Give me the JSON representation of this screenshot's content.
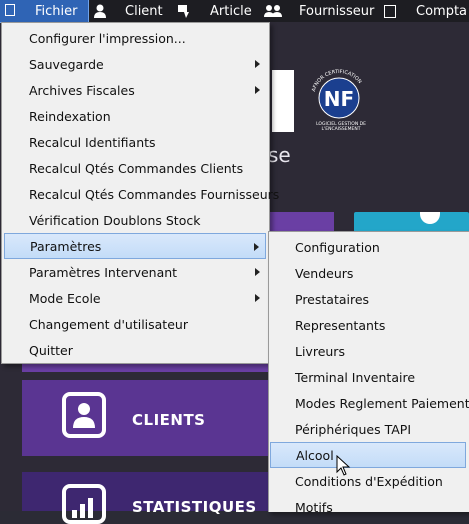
{
  "menubar": {
    "items": [
      {
        "label": "Fichier",
        "icon": "file-icon",
        "active": true
      },
      {
        "label": "Client",
        "icon": "person-icon"
      },
      {
        "label": "Article",
        "icon": "tag-icon"
      },
      {
        "label": "Fournisseur",
        "icon": "people-icon"
      },
      {
        "label": "Compta",
        "icon": "calculator-icon"
      }
    ]
  },
  "background": {
    "cert_logo_text": "NF",
    "cert_logo_sub": "LOGICIEL GESTION DE L'ENCAISSEMENT",
    "cert_logo_arc": "AFNOR CERTIFICATION",
    "partial_text": "se",
    "tiles": [
      {
        "label": "CLIENTS",
        "icon": "client-card-icon"
      },
      {
        "label": "STATISTIQUES",
        "icon": "bar-chart-icon"
      }
    ]
  },
  "fichier_menu": {
    "items": [
      {
        "label": "Configurer l'impression...",
        "submenu": false
      },
      {
        "label": "Sauvegarde",
        "submenu": true
      },
      {
        "label": "Archives Fiscales",
        "submenu": true
      },
      {
        "label": "Reindexation",
        "submenu": false
      },
      {
        "label": "Recalcul Identifiants",
        "submenu": false
      },
      {
        "label": "Recalcul Qtés Commandes Clients",
        "submenu": false
      },
      {
        "label": "Recalcul Qtés Commandes Fournisseurs",
        "submenu": false
      },
      {
        "label": "Vérification Doublons Stock",
        "submenu": false
      },
      {
        "label": "Paramètres",
        "submenu": true,
        "highlighted": true
      },
      {
        "label": "Paramètres Intervenant",
        "submenu": true
      },
      {
        "label": "Mode Ecole",
        "submenu": true
      },
      {
        "label": "Changement d'utilisateur",
        "submenu": false
      },
      {
        "label": "Quitter",
        "submenu": false
      }
    ]
  },
  "parametres_menu": {
    "items": [
      {
        "label": "Configuration"
      },
      {
        "label": "Vendeurs"
      },
      {
        "label": "Prestataires"
      },
      {
        "label": "Representants"
      },
      {
        "label": "Livreurs"
      },
      {
        "label": "Terminal Inventaire"
      },
      {
        "label": "Modes Reglement Paiement"
      },
      {
        "label": "Périphériques TAPI"
      },
      {
        "label": "Alcool",
        "highlighted": true
      },
      {
        "label": "Conditions d'Expédition"
      },
      {
        "label": "Motifs"
      }
    ]
  },
  "colors": {
    "menubar_bg": "#1d1d22",
    "active_menu": "#2f64b5",
    "tile_purple": "#5a3592",
    "teal": "#23a6c9",
    "highlight": "#c3dcf8"
  }
}
